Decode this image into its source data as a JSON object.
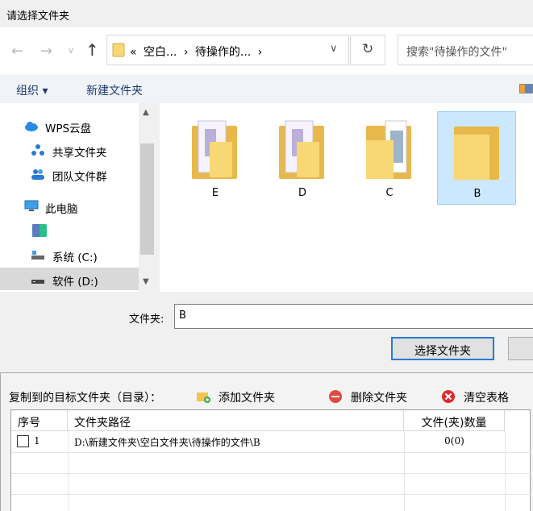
{
  "window": {
    "title": "请选择文件夹"
  },
  "nav": {
    "back_glyph": "←",
    "forward_glyph": "→",
    "recent_glyph": "∨",
    "up_glyph": "↑",
    "address": {
      "overflow": "«",
      "seg1": "空白...",
      "sep": "›",
      "seg2": "待操作的...",
      "sep2": "›",
      "dropdown_glyph": "∨"
    },
    "refresh_glyph": "↻",
    "search_placeholder": "搜索\"待操作的文件\""
  },
  "commandbar": {
    "organize": "组织 ▾",
    "new_folder": "新建文件夹"
  },
  "tree": {
    "items": [
      {
        "label": "WPS云盘",
        "icon": "cloud-icon"
      },
      {
        "label": "共享文件夹",
        "icon": "share-icon"
      },
      {
        "label": "团队文件群",
        "icon": "team-icon"
      },
      {
        "label": "此电脑",
        "icon": "computer-icon"
      },
      {
        "label": "",
        "icon": "app-icon"
      },
      {
        "label": "系统 (C:)",
        "icon": "drive-c-icon"
      },
      {
        "label": "软件 (D:)",
        "icon": "drive-d-icon"
      }
    ],
    "scroll_up": "▲",
    "scroll_down": "▼"
  },
  "folders": [
    {
      "name": "E",
      "thumb": "photo",
      "selected": false
    },
    {
      "name": "D",
      "thumb": "photo",
      "selected": false
    },
    {
      "name": "C",
      "thumb": "doc",
      "selected": false
    },
    {
      "name": "B",
      "thumb": "empty",
      "selected": true
    }
  ],
  "filename": {
    "label": "文件夹:",
    "value": "B"
  },
  "buttons": {
    "select": "选择文件夹",
    "cancel": ""
  },
  "panel": {
    "title": "复制到的目标文件夹（目录）：",
    "add": "添加文件夹",
    "delete": "删除文件夹",
    "clear": "清空表格",
    "columns": {
      "seq": "序号",
      "path": "文件夹路径",
      "count": "文件(夹)数量"
    },
    "rows": [
      {
        "seq": "1",
        "path": "D:\\新建文件夹\\空白文件夹\\待操作的文件\\B",
        "count": "0(0)"
      }
    ]
  },
  "colors": {
    "accent": "#2b78d9",
    "selection": "#cce8ff",
    "folder": "#f8d775",
    "link": "#1e3a6e"
  }
}
